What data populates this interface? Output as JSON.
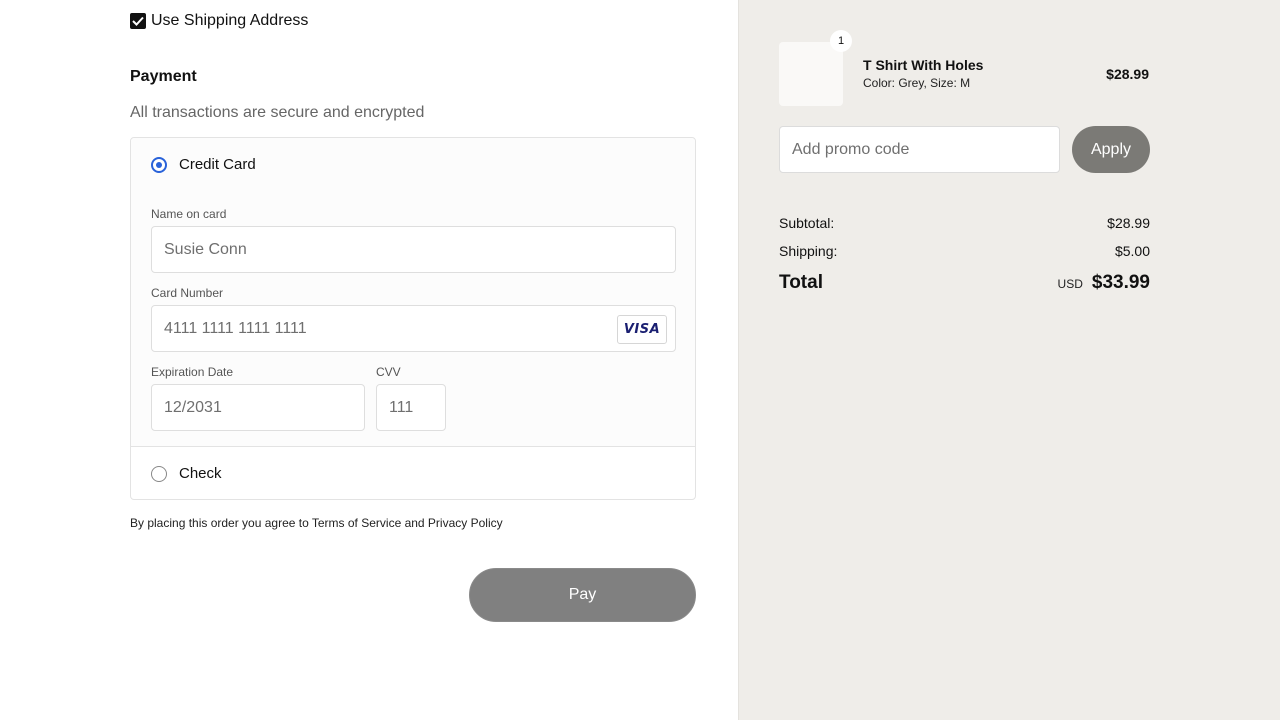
{
  "shipping": {
    "use_shipping_label": "Use Shipping Address",
    "checked": true
  },
  "payment": {
    "title": "Payment",
    "subtitle": "All transactions are secure and encrypted",
    "credit_card": {
      "label": "Credit Card",
      "selected": true,
      "name_label": "Name on card",
      "name_placeholder": "Susie Conn",
      "number_label": "Card Number",
      "number_placeholder": "4111 1111 1111 1111",
      "card_brand": "VISA",
      "expiry_label": "Expiration Date",
      "expiry_placeholder": "12/2031",
      "cvv_label": "CVV",
      "cvv_placeholder": "111"
    },
    "check": {
      "label": "Check",
      "selected": false
    },
    "terms": "By placing this order you agree to Terms of Service and Privacy Policy",
    "pay_label": "Pay"
  },
  "summary": {
    "item": {
      "name": "T Shirt With Holes",
      "variant": "Color: Grey, Size: M",
      "price": "$28.99",
      "quantity": "1"
    },
    "promo_placeholder": "Add promo code",
    "apply_label": "Apply",
    "subtotal_label": "Subtotal:",
    "subtotal_value": "$28.99",
    "shipping_label": "Shipping:",
    "shipping_value": "$5.00",
    "total_label": "Total",
    "currency": "USD",
    "total_value": "$33.99"
  },
  "colors": {
    "accent_radio": "#2962d9",
    "pay_button": "#808080",
    "apply_button": "#7b7a76",
    "summary_bg": "#efede9"
  }
}
